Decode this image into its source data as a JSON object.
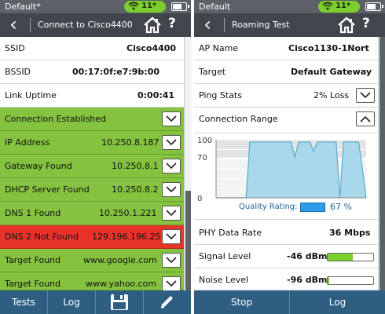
{
  "left": {
    "status": {
      "title": "Default*",
      "battery_label": "11*"
    },
    "nav": {
      "title": "Connect to Cisco4400"
    },
    "rows": [
      {
        "label": "SSID",
        "value": "Cisco4400"
      },
      {
        "label": "BSSID",
        "value": "00:17:0f:e7:9b:00"
      },
      {
        "label": "Link Uptime",
        "value": "0:00:41"
      },
      {
        "label": "Connection Established",
        "value": ""
      },
      {
        "label": "IP Address",
        "value": "10.250.8.187"
      },
      {
        "label": "Gateway Found",
        "value": "10.250.8.1"
      },
      {
        "label": "DHCP Server Found",
        "value": "10.250.8.2"
      },
      {
        "label": "DNS 1 Found",
        "value": "10.250.1.221"
      },
      {
        "label": "DNS 2 Not Found",
        "value": "129.196.196.25"
      },
      {
        "label": "Target Found",
        "value": "www.google.com"
      },
      {
        "label": "Target Found",
        "value": "www.yahoo.com"
      }
    ],
    "bottom": {
      "tests": "Tests",
      "log": "Log"
    }
  },
  "right": {
    "status": {
      "title": "Default",
      "battery_label": "11*"
    },
    "nav": {
      "title": "Roaming Test"
    },
    "rows": {
      "ap_name": {
        "label": "AP Name",
        "value": "Cisco1130-1Nort"
      },
      "target": {
        "label": "Target",
        "value": "Default Gateway"
      },
      "ping": {
        "label": "Ping Stats",
        "value": "2% Loss"
      },
      "range": {
        "label": "Connection Range"
      },
      "phy": {
        "label": "PHY Data Rate",
        "value": "36 Mbps"
      },
      "signal": {
        "label": "Signal Level",
        "value": "-46 dBm",
        "level": 0.55
      },
      "noise": {
        "label": "Noise Level",
        "value": "-96 dBm",
        "level": 0.03
      }
    },
    "quality": {
      "label": "Quality Rating:",
      "value": "67 %",
      "level": 0.67
    },
    "bottom": {
      "stop": "Stop",
      "log": "Log"
    }
  },
  "chart_data": {
    "type": "area",
    "y_ticks": [
      "100",
      "70",
      "0"
    ],
    "ylim": [
      0,
      100
    ],
    "x": [
      0,
      1,
      2,
      3,
      4,
      5,
      6,
      7,
      8,
      9,
      10,
      11,
      12,
      13,
      14,
      15,
      16,
      17,
      18,
      19,
      20,
      21,
      22,
      23,
      24,
      25,
      26,
      27,
      28,
      29,
      30,
      31,
      32,
      33,
      34,
      35,
      36,
      37,
      38,
      39,
      40
    ],
    "values": [
      0,
      0,
      0,
      0,
      0,
      0,
      0,
      0,
      0,
      96,
      96,
      96,
      96,
      96,
      96,
      96,
      96,
      96,
      96,
      96,
      96,
      70,
      96,
      96,
      96,
      96,
      80,
      96,
      96,
      96,
      96,
      96,
      96,
      0,
      96,
      96,
      96,
      96,
      96,
      50,
      0
    ],
    "colors": {
      "fill": "#a9d8ea",
      "line": "#5aa9cf",
      "band": "#e1e3e5"
    }
  },
  "colors": {
    "ok": "#85c23f",
    "error": "#e8332b",
    "bar": "#2e5f82",
    "accent": "#2b9de8"
  }
}
